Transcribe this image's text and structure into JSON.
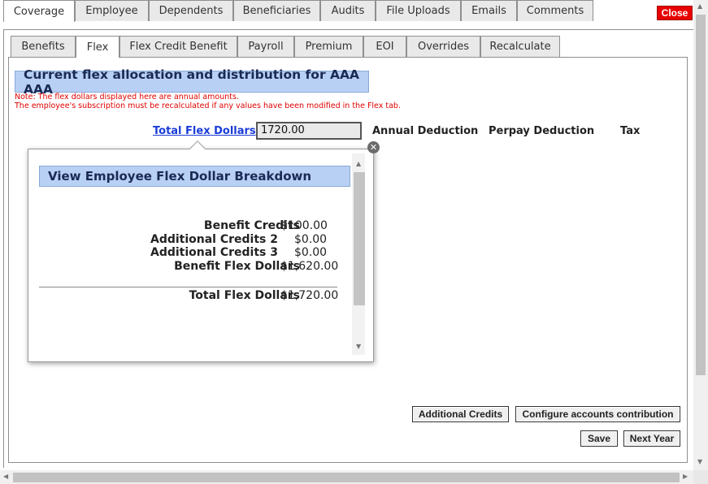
{
  "tabs": [
    "Coverage",
    "Employee",
    "Dependents",
    "Beneficiaries",
    "Audits",
    "File Uploads",
    "Emails",
    "Comments"
  ],
  "subtabs": [
    "Benefits",
    "Flex",
    "Flex Credit Benefit",
    "Payroll",
    "Premium",
    "EOI",
    "Overrides",
    "Recalculate"
  ],
  "close_label": "Close",
  "section_title": "Current flex allocation and distribution for AAA AAA",
  "notes": [
    "Note: The flex dollars displayed here are annual amounts.",
    "The employee's subscription must be recalculated if any values have been modified in the Flex tab."
  ],
  "total_flex_link": "Total Flex Dollars",
  "total_flex_value": "1720.00",
  "columns": [
    "Annual Deduction",
    "Perpay Deduction",
    "Tax"
  ],
  "popup": {
    "title": "View Employee Flex Dollar Breakdown",
    "rows": [
      {
        "label": "Benefit Credits",
        "value": "$100.00"
      },
      {
        "label": "Additional Credits 2",
        "value": "$0.00"
      },
      {
        "label": "Additional Credits 3",
        "value": "$0.00"
      },
      {
        "label": "Benefit Flex Dollars",
        "value": "$1,620.00"
      }
    ],
    "total": {
      "label": "Total Flex Dollars",
      "value": "$1,720.00"
    }
  },
  "buttons": {
    "additional_credits": "Additional Credits",
    "configure": "Configure accounts contribution",
    "save": "Save",
    "next_year": "Next Year"
  },
  "colors": {
    "accent": "#b8d0f4",
    "close": "#e80000",
    "link": "#1a3cd8",
    "note": "#e00000"
  },
  "icons": [
    "close-circle-icon",
    "scroll-up-arrow-icon",
    "scroll-down-arrow-icon",
    "scroll-left-arrow-icon",
    "scroll-right-arrow-icon"
  ]
}
